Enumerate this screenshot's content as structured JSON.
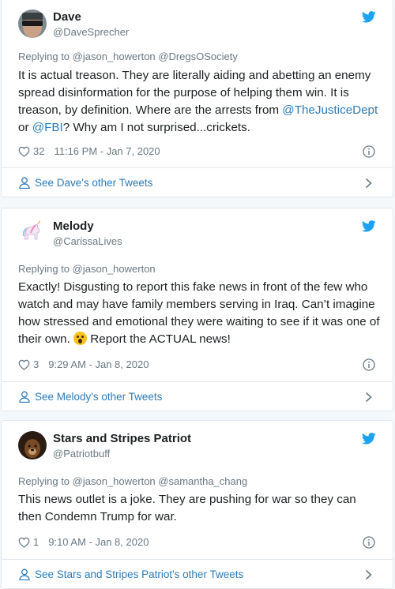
{
  "tweets": [
    {
      "name": "Dave",
      "handle": "@DaveSprecher",
      "reply_prefix": "Replying to",
      "reply_to": "@jason_howerton @DregsOSociety",
      "text_parts": [
        {
          "t": "It is actual treason. They are literally aiding and abetting an enemy spread disinformation for the purpose of helping them win. It is treason, by definition. Where are the arrests from "
        },
        {
          "t": "@TheJusticeDept",
          "link": true
        },
        {
          "t": " or "
        },
        {
          "t": "@FBI",
          "link": true
        },
        {
          "t": "? Why am I not surprised...crickets."
        }
      ],
      "likes": "32",
      "timestamp": "11:16 PM - Jan 7, 2020",
      "footer": "See Dave's other Tweets",
      "avatar_icon": "avatar-sunglasses"
    },
    {
      "name": "Melody",
      "handle": "@CarissaLives",
      "reply_prefix": "Replying to",
      "reply_to": "@jason_howerton",
      "text_parts": [
        {
          "t": "Exactly! Disgusting to report this fake news in front of the few who watch and may have family members serving in Iraq. Can’t imagine how stressed and emotional they were waiting to see if it was one of their own. "
        },
        {
          "emoji": "astonished-face"
        },
        {
          "t": " Report the ACTUAL news!"
        }
      ],
      "likes": "3",
      "timestamp": "9:29 AM - Jan 8, 2020",
      "footer": "See Melody's other Tweets",
      "avatar_icon": "avatar-unicorn"
    },
    {
      "name": "Stars and Stripes Patriot",
      "handle": "@Patriotbuff",
      "reply_prefix": "Replying to",
      "reply_to": "@jason_howerton @samantha_chang",
      "text_parts": [
        {
          "t": "This news outlet is a joke. They are pushing for war so they can then Condemn Trump for war."
        }
      ],
      "likes": "1",
      "timestamp": "9:10 AM - Jan 8, 2020",
      "footer": "See Stars and Stripes Patriot's other Tweets",
      "avatar_icon": "avatar-dog"
    }
  ],
  "colors": {
    "link": "#2b7bb9",
    "twitter_blue": "#1da1f2",
    "muted": "#697882",
    "border": "#e1e8ed"
  }
}
